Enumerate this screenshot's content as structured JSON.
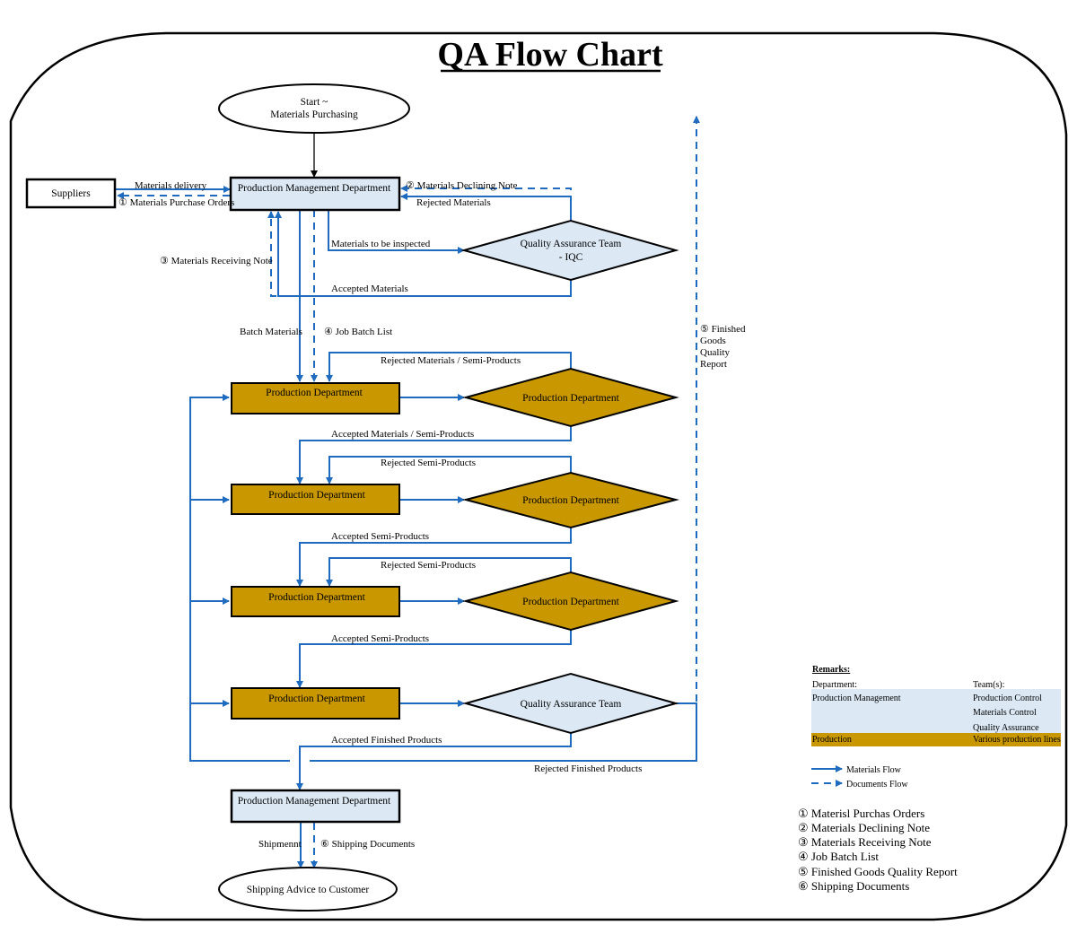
{
  "title": "QA Flow Chart",
  "colors": {
    "flow": "#1f6bbf",
    "pm_fill": "#dce9f5",
    "prod_fill": "#c99700",
    "outline": "#000000"
  },
  "nodes": {
    "start": [
      "Start ~",
      "Materials Purchasing"
    ],
    "suppliers": "Suppliers",
    "pm_top": "Production Management Department",
    "iqc": [
      "Quality Assurance Team",
      "-  IQC"
    ],
    "prod_1": "Production Department",
    "prod_check_1": "Production Department",
    "prod_2": "Production Department",
    "prod_check_2": "Production Department",
    "prod_3": "Production Department",
    "prod_check_3": "Production Department",
    "prod_4": "Production Department",
    "qa_final": "Quality Assurance Team",
    "pm_bottom": "Production Management Department",
    "end": "Shipping Advice to Customer"
  },
  "edges": {
    "materials_delivery": "Materials delivery",
    "purchase_orders": "① Materials Purchase Orders",
    "declining_note": "② Materials Declining Note",
    "rejected_materials": "Rejected Materials",
    "to_be_inspected": "Materials to be inspected",
    "receiving_note": "③  Materials Receiving Note",
    "accepted_materials": "Accepted Materials",
    "batch_materials": "Batch Materials",
    "job_batch_list": "④ Job Batch List",
    "rejected_mat_semi": "Rejected Materials / Semi-Products",
    "accepted_mat_semi": "Accepted Materials / Semi-Products",
    "rejected_semi_1": "Rejected Semi-Products",
    "accepted_semi_1": "Accepted Semi-Products",
    "rejected_semi_2": "Rejected Semi-Products",
    "accepted_semi_2": "Accepted Semi-Products",
    "accepted_finished": "Accepted Finished Products",
    "rejected_finished": "Rejected Finished Products",
    "fg_report": [
      "⑤ Finished",
      "Goods",
      "Quality",
      "Report"
    ],
    "shipment": "Shipmennt",
    "shipping_docs": "⑥  Shipping Documents"
  },
  "remarks": {
    "heading": "Remarks:",
    "dept_header": "Department:",
    "team_header": "Team(s):",
    "rows": [
      {
        "dept": "Production Management",
        "teams": [
          "Production Control",
          "Materials Control",
          "Quality Assurance"
        ]
      },
      {
        "dept": "Production",
        "teams": [
          "Various production lines"
        ]
      }
    ],
    "materials_flow": "Materials Flow",
    "documents_flow": "Documents Flow"
  },
  "documents_legend": [
    "① Materisl Purchas Orders",
    "② Materials Declining Note",
    "③ Materials Receiving Note",
    "④ Job Batch List",
    "⑤ Finished Goods Quality Report",
    "⑥ Shipping Documents"
  ]
}
